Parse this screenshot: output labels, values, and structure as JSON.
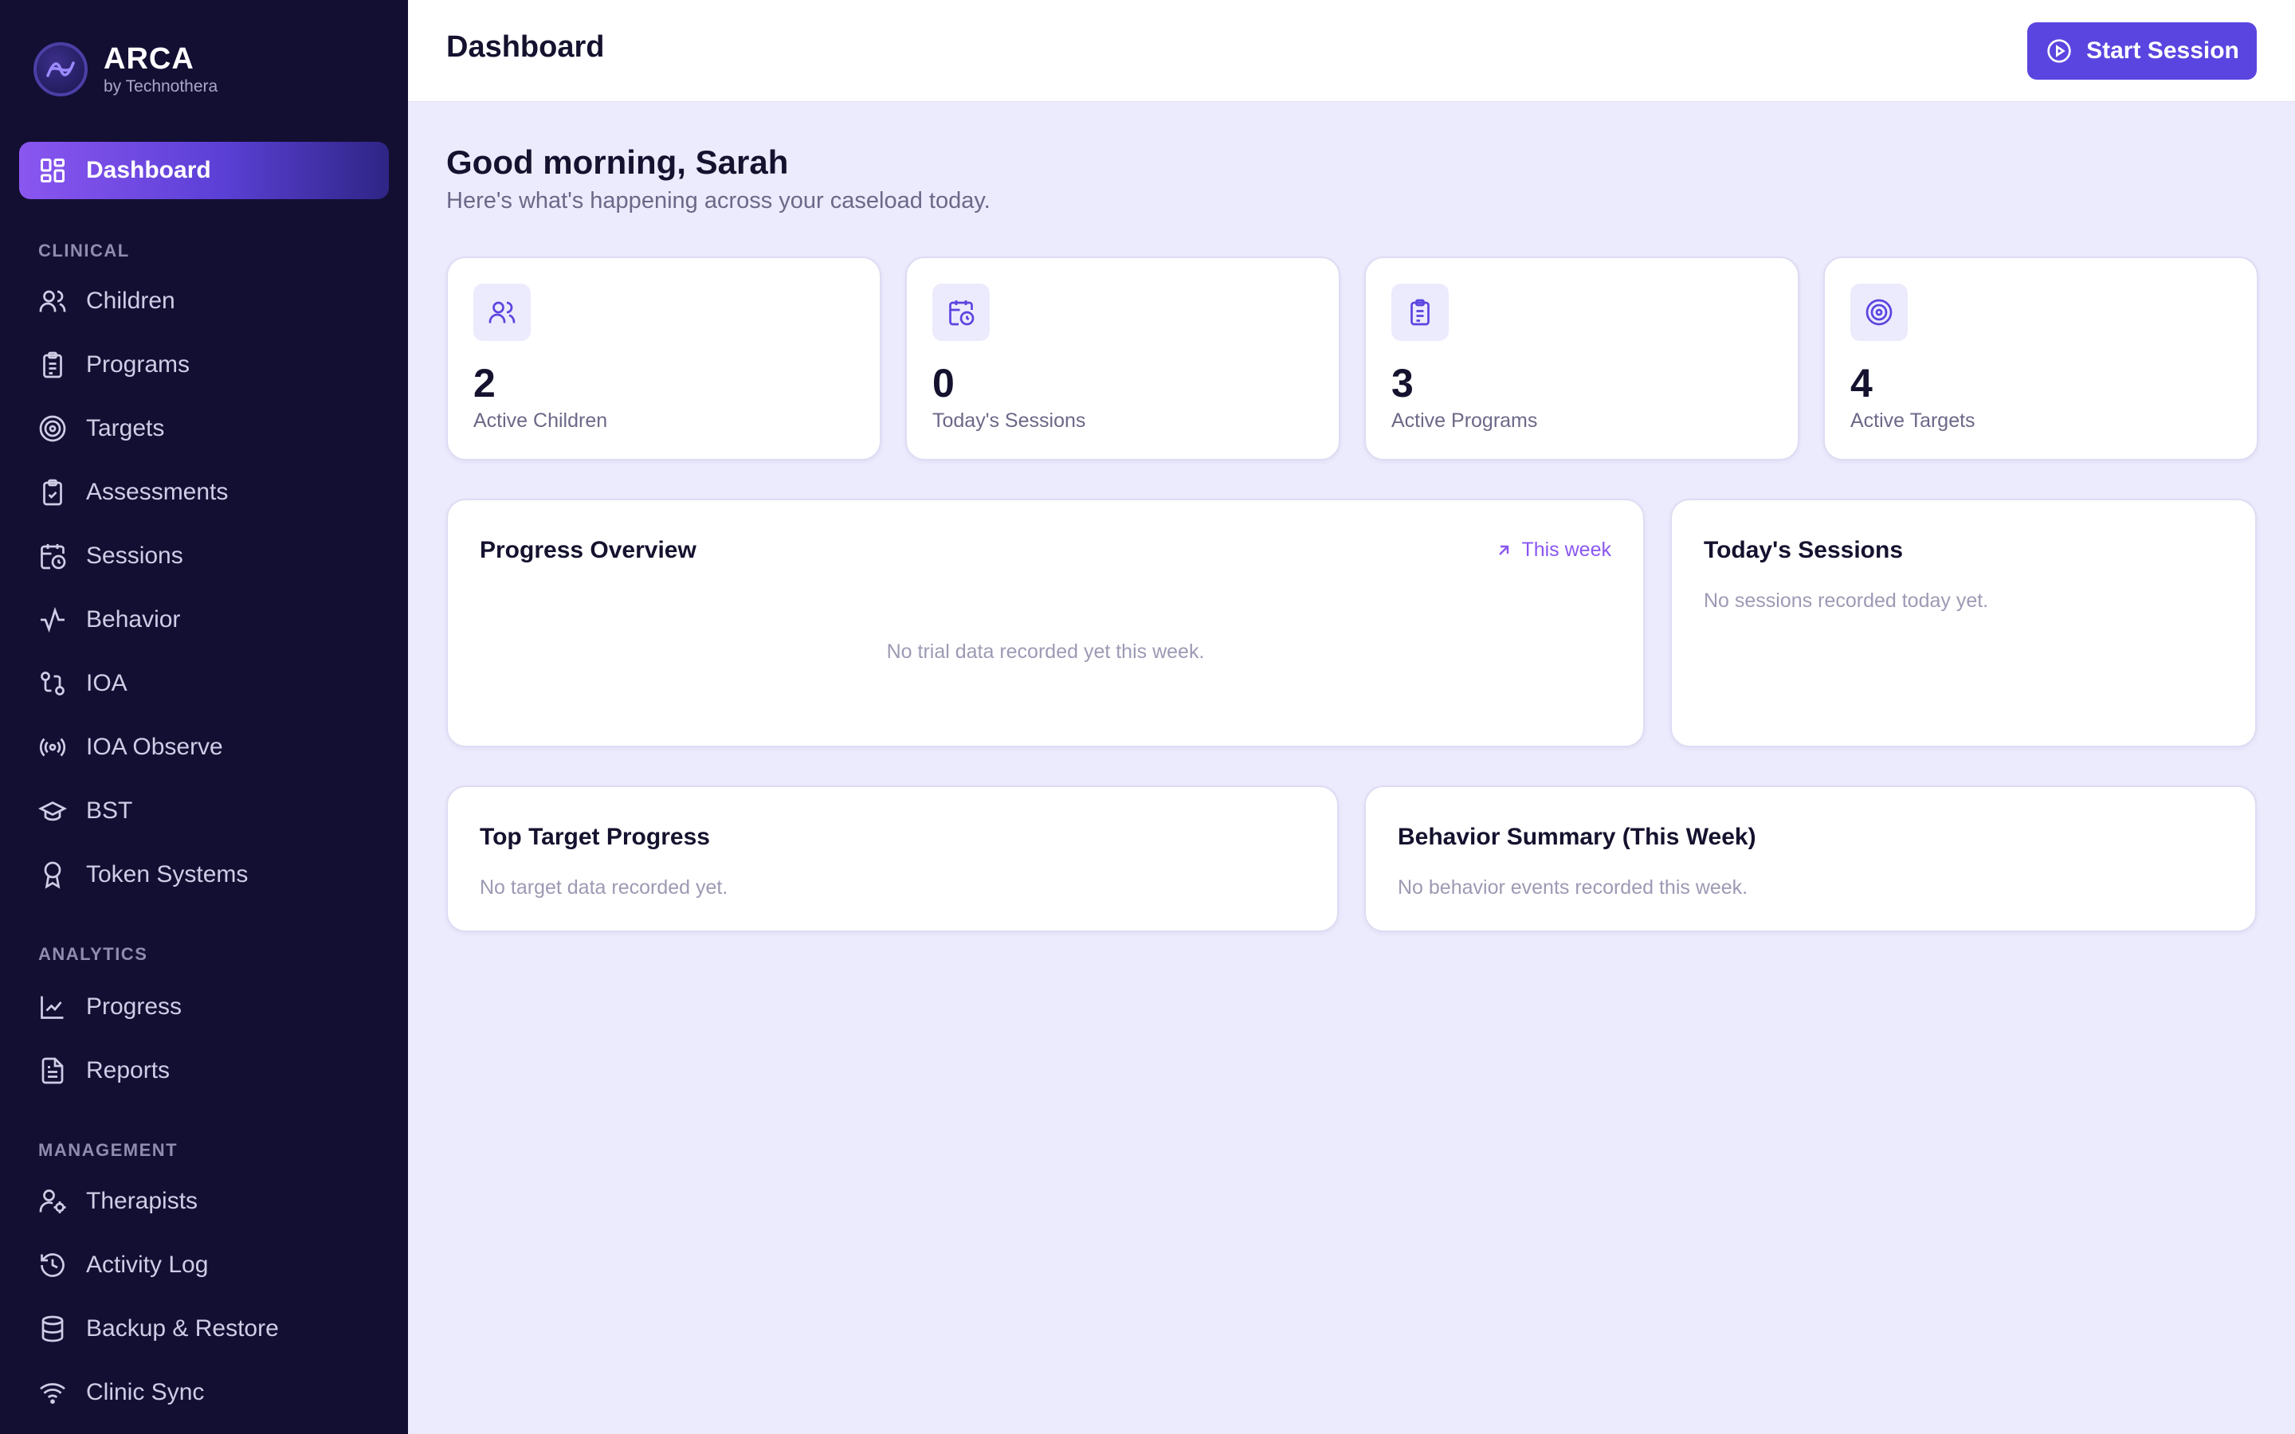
{
  "brand": {
    "name": "ARCA",
    "sub": "by Technothera"
  },
  "sidebar": {
    "active": {
      "label": "Dashboard",
      "icon": "dashboard-grid-icon"
    },
    "sections": [
      {
        "title": "CLINICAL",
        "items": [
          {
            "label": "Children",
            "icon": "users-icon"
          },
          {
            "label": "Programs",
            "icon": "clipboard-list-icon"
          },
          {
            "label": "Targets",
            "icon": "target-icon"
          },
          {
            "label": "Assessments",
            "icon": "clipboard-check-icon"
          },
          {
            "label": "Sessions",
            "icon": "calendar-clock-icon"
          },
          {
            "label": "Behavior",
            "icon": "activity-icon"
          },
          {
            "label": "IOA",
            "icon": "git-compare-icon"
          },
          {
            "label": "IOA Observe",
            "icon": "radio-icon"
          },
          {
            "label": "BST",
            "icon": "graduation-cap-icon"
          },
          {
            "label": "Token Systems",
            "icon": "award-icon"
          }
        ]
      },
      {
        "title": "ANALYTICS",
        "items": [
          {
            "label": "Progress",
            "icon": "line-chart-icon"
          },
          {
            "label": "Reports",
            "icon": "file-text-icon"
          }
        ]
      },
      {
        "title": "MANAGEMENT",
        "items": [
          {
            "label": "Therapists",
            "icon": "user-cog-icon"
          },
          {
            "label": "Activity Log",
            "icon": "history-icon"
          },
          {
            "label": "Backup & Restore",
            "icon": "database-icon"
          },
          {
            "label": "Clinic Sync",
            "icon": "wifi-icon"
          }
        ]
      }
    ]
  },
  "header": {
    "title": "Dashboard",
    "start_label": "Start Session"
  },
  "main": {
    "greeting": "Good morning, Sarah",
    "subtitle": "Here's what's happening across your caseload today.",
    "stats": [
      {
        "value": "2",
        "label": "Active Children",
        "icon": "users-icon"
      },
      {
        "value": "0",
        "label": "Today's Sessions",
        "icon": "calendar-clock-icon"
      },
      {
        "value": "3",
        "label": "Active Programs",
        "icon": "clipboard-list-icon"
      },
      {
        "value": "4",
        "label": "Active Targets",
        "icon": "target-icon"
      }
    ],
    "progress": {
      "title": "Progress Overview",
      "range": "This week",
      "empty": "No trial data recorded yet this week."
    },
    "sessions": {
      "title": "Today's Sessions",
      "empty": "No sessions recorded today yet."
    },
    "top_targets": {
      "title": "Top Target Progress",
      "empty": "No target data recorded yet."
    },
    "behavior": {
      "title": "Behavior Summary (This Week)",
      "empty": "No behavior events recorded this week."
    }
  },
  "colors": {
    "sidebar": "#130f33",
    "accent": "#5a45e0",
    "accent_light": "#8a56f0",
    "background": "#ecebfd"
  }
}
